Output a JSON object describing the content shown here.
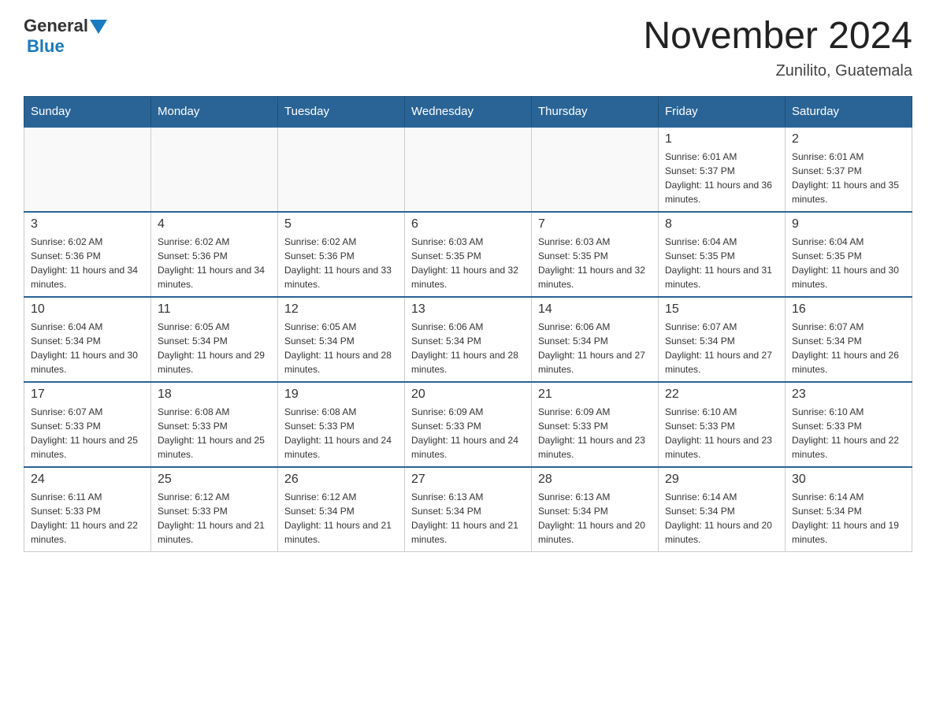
{
  "logo": {
    "text_general": "General",
    "text_blue": "Blue"
  },
  "title": "November 2024",
  "subtitle": "Zunilito, Guatemala",
  "days_of_week": [
    "Sunday",
    "Monday",
    "Tuesday",
    "Wednesday",
    "Thursday",
    "Friday",
    "Saturday"
  ],
  "weeks": [
    [
      {
        "day": "",
        "info": ""
      },
      {
        "day": "",
        "info": ""
      },
      {
        "day": "",
        "info": ""
      },
      {
        "day": "",
        "info": ""
      },
      {
        "day": "",
        "info": ""
      },
      {
        "day": "1",
        "info": "Sunrise: 6:01 AM\nSunset: 5:37 PM\nDaylight: 11 hours and 36 minutes."
      },
      {
        "day": "2",
        "info": "Sunrise: 6:01 AM\nSunset: 5:37 PM\nDaylight: 11 hours and 35 minutes."
      }
    ],
    [
      {
        "day": "3",
        "info": "Sunrise: 6:02 AM\nSunset: 5:36 PM\nDaylight: 11 hours and 34 minutes."
      },
      {
        "day": "4",
        "info": "Sunrise: 6:02 AM\nSunset: 5:36 PM\nDaylight: 11 hours and 34 minutes."
      },
      {
        "day": "5",
        "info": "Sunrise: 6:02 AM\nSunset: 5:36 PM\nDaylight: 11 hours and 33 minutes."
      },
      {
        "day": "6",
        "info": "Sunrise: 6:03 AM\nSunset: 5:35 PM\nDaylight: 11 hours and 32 minutes."
      },
      {
        "day": "7",
        "info": "Sunrise: 6:03 AM\nSunset: 5:35 PM\nDaylight: 11 hours and 32 minutes."
      },
      {
        "day": "8",
        "info": "Sunrise: 6:04 AM\nSunset: 5:35 PM\nDaylight: 11 hours and 31 minutes."
      },
      {
        "day": "9",
        "info": "Sunrise: 6:04 AM\nSunset: 5:35 PM\nDaylight: 11 hours and 30 minutes."
      }
    ],
    [
      {
        "day": "10",
        "info": "Sunrise: 6:04 AM\nSunset: 5:34 PM\nDaylight: 11 hours and 30 minutes."
      },
      {
        "day": "11",
        "info": "Sunrise: 6:05 AM\nSunset: 5:34 PM\nDaylight: 11 hours and 29 minutes."
      },
      {
        "day": "12",
        "info": "Sunrise: 6:05 AM\nSunset: 5:34 PM\nDaylight: 11 hours and 28 minutes."
      },
      {
        "day": "13",
        "info": "Sunrise: 6:06 AM\nSunset: 5:34 PM\nDaylight: 11 hours and 28 minutes."
      },
      {
        "day": "14",
        "info": "Sunrise: 6:06 AM\nSunset: 5:34 PM\nDaylight: 11 hours and 27 minutes."
      },
      {
        "day": "15",
        "info": "Sunrise: 6:07 AM\nSunset: 5:34 PM\nDaylight: 11 hours and 27 minutes."
      },
      {
        "day": "16",
        "info": "Sunrise: 6:07 AM\nSunset: 5:34 PM\nDaylight: 11 hours and 26 minutes."
      }
    ],
    [
      {
        "day": "17",
        "info": "Sunrise: 6:07 AM\nSunset: 5:33 PM\nDaylight: 11 hours and 25 minutes."
      },
      {
        "day": "18",
        "info": "Sunrise: 6:08 AM\nSunset: 5:33 PM\nDaylight: 11 hours and 25 minutes."
      },
      {
        "day": "19",
        "info": "Sunrise: 6:08 AM\nSunset: 5:33 PM\nDaylight: 11 hours and 24 minutes."
      },
      {
        "day": "20",
        "info": "Sunrise: 6:09 AM\nSunset: 5:33 PM\nDaylight: 11 hours and 24 minutes."
      },
      {
        "day": "21",
        "info": "Sunrise: 6:09 AM\nSunset: 5:33 PM\nDaylight: 11 hours and 23 minutes."
      },
      {
        "day": "22",
        "info": "Sunrise: 6:10 AM\nSunset: 5:33 PM\nDaylight: 11 hours and 23 minutes."
      },
      {
        "day": "23",
        "info": "Sunrise: 6:10 AM\nSunset: 5:33 PM\nDaylight: 11 hours and 22 minutes."
      }
    ],
    [
      {
        "day": "24",
        "info": "Sunrise: 6:11 AM\nSunset: 5:33 PM\nDaylight: 11 hours and 22 minutes."
      },
      {
        "day": "25",
        "info": "Sunrise: 6:12 AM\nSunset: 5:33 PM\nDaylight: 11 hours and 21 minutes."
      },
      {
        "day": "26",
        "info": "Sunrise: 6:12 AM\nSunset: 5:34 PM\nDaylight: 11 hours and 21 minutes."
      },
      {
        "day": "27",
        "info": "Sunrise: 6:13 AM\nSunset: 5:34 PM\nDaylight: 11 hours and 21 minutes."
      },
      {
        "day": "28",
        "info": "Sunrise: 6:13 AM\nSunset: 5:34 PM\nDaylight: 11 hours and 20 minutes."
      },
      {
        "day": "29",
        "info": "Sunrise: 6:14 AM\nSunset: 5:34 PM\nDaylight: 11 hours and 20 minutes."
      },
      {
        "day": "30",
        "info": "Sunrise: 6:14 AM\nSunset: 5:34 PM\nDaylight: 11 hours and 19 minutes."
      }
    ]
  ]
}
